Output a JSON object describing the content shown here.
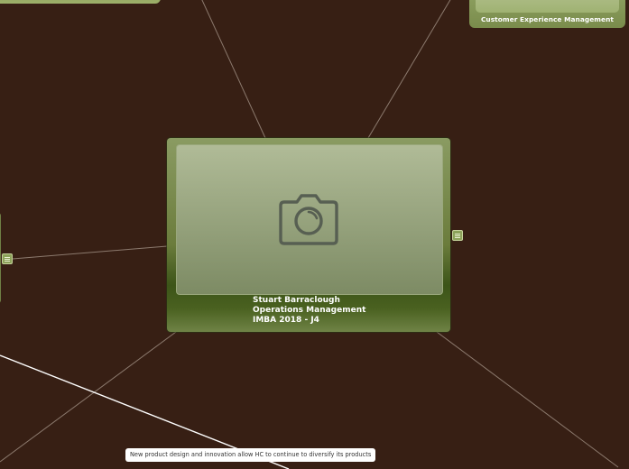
{
  "central_node": {
    "lines": [
      "Stuart Barraclough",
      "Operations Management",
      "IMBA 2018 - J4"
    ],
    "image": "camera-icon"
  },
  "nodes": {
    "top_right_label": "Customer Experience Management"
  },
  "relationship_label": "New product design and innovation allow HC to continue to diversify its products",
  "colors": {
    "background": "#371f14",
    "node_green": "#8fa262",
    "link": "#8c7a6e"
  }
}
